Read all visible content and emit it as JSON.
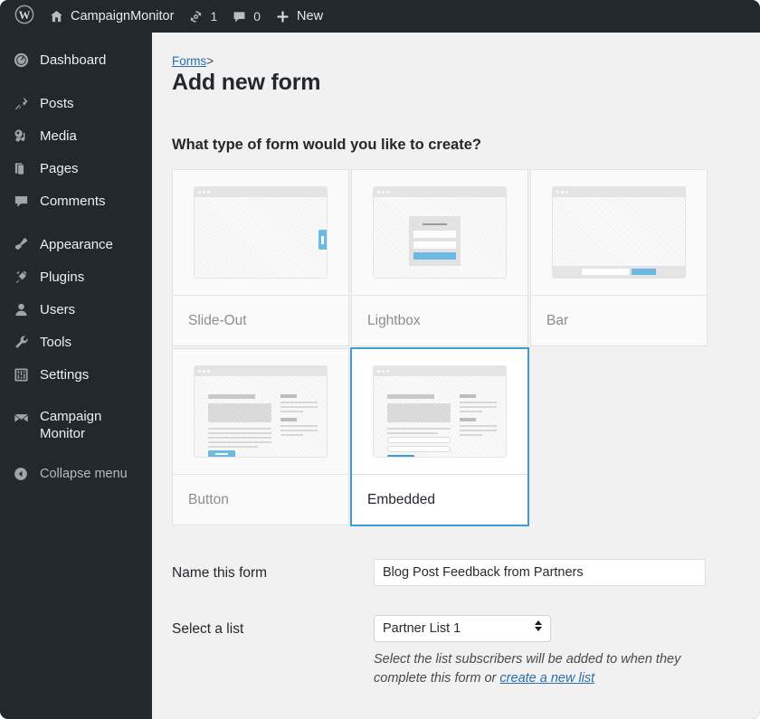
{
  "adminbar": {
    "logo_icon": "wordpress-logo-icon",
    "site_icon": "home-icon",
    "site_name": "CampaignMonitor",
    "updates_icon": "updates-icon",
    "updates_count": "1",
    "comments_icon": "comment-bubble-icon",
    "comments_count": "0",
    "new_icon": "plus-icon",
    "new_label": "New"
  },
  "sidebar": {
    "items": [
      {
        "label": "Dashboard",
        "icon": "dashboard-icon"
      },
      {
        "label": "Posts",
        "icon": "pin-icon"
      },
      {
        "label": "Media",
        "icon": "media-icon"
      },
      {
        "label": "Pages",
        "icon": "pages-icon"
      },
      {
        "label": "Comments",
        "icon": "comment-bubble-icon"
      },
      {
        "label": "Appearance",
        "icon": "paintbrush-icon"
      },
      {
        "label": "Plugins",
        "icon": "plug-icon"
      },
      {
        "label": "Users",
        "icon": "user-icon"
      },
      {
        "label": "Tools",
        "icon": "wrench-icon"
      },
      {
        "label": "Settings",
        "icon": "settings-sliders-icon"
      },
      {
        "label": "Campaign Monitor",
        "icon": "campaign-monitor-icon"
      }
    ],
    "collapse": {
      "label": "Collapse menu",
      "icon": "collapse-arrow-icon"
    }
  },
  "content": {
    "breadcrumb": {
      "link": "Forms",
      "separator": ">"
    },
    "page_title": "Add new form",
    "section_question": "What type of form would you like to create?",
    "form_types": [
      {
        "id": "slide-out",
        "label": "Slide-Out",
        "selected": false
      },
      {
        "id": "lightbox",
        "label": "Lightbox",
        "selected": false
      },
      {
        "id": "bar",
        "label": "Bar",
        "selected": false
      },
      {
        "id": "button",
        "label": "Button",
        "selected": false
      },
      {
        "id": "embedded",
        "label": "Embedded",
        "selected": true
      }
    ],
    "fields": {
      "name_label": "Name this form",
      "name_value": "Blog Post Feedback from Partners",
      "name_placeholder": "",
      "list_label": "Select a list",
      "list_value": "Partner List 1",
      "help_text_before": "Select the list subscribers will be added to when they complete this form or ",
      "help_link": "create a new list"
    }
  },
  "colors": {
    "admin_dark": "#23282d",
    "content_bg": "#f1f1f1",
    "accent_blue": "#3d9cd2",
    "link_blue": "#2b6ea8",
    "light_blue": "#6cb9e3"
  }
}
